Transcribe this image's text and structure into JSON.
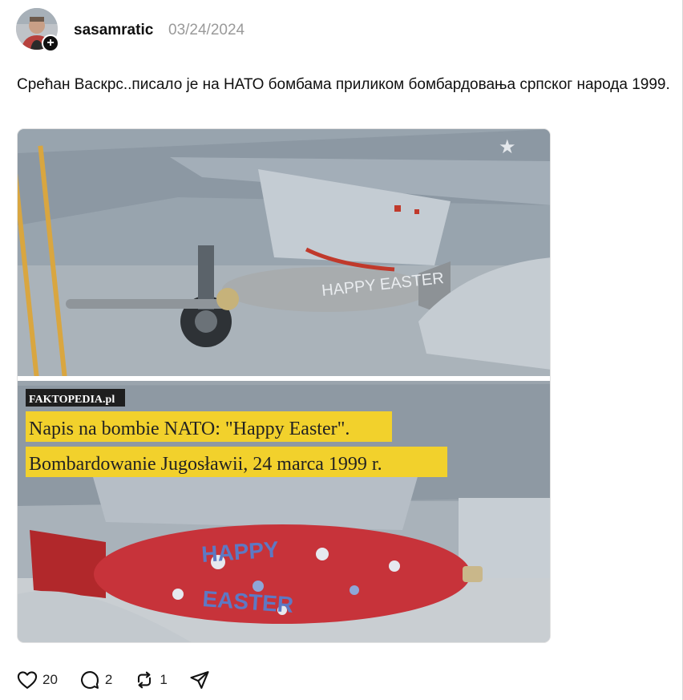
{
  "post": {
    "username": "sasamratic",
    "date": "03/24/2024",
    "text": "Срећан Васкрс..писало је на НАТО бомбама приликом бомбардовања српског народа 1999."
  },
  "image": {
    "watermark": "FAKTOPEDIA.pl",
    "caption_line1": "Napis na bombie NATO: \"Happy Easter\".",
    "caption_line2": "Bombardowanie Jugosławii, 24 marca 1999 r.",
    "bomb_text_top": "HAPPY EASTER",
    "bomb_text_bottom_1": "HAPPY",
    "bomb_text_bottom_2": "EASTER"
  },
  "actions": {
    "likes": "20",
    "replies": "2",
    "reposts": "1"
  },
  "icons": {
    "follow": "plus-icon",
    "like": "heart-icon",
    "reply": "comment-icon",
    "repost": "repost-icon",
    "share": "send-icon"
  },
  "colors": {
    "caption_bg": "#f2d12c",
    "muted_text": "#9a9a9a"
  }
}
